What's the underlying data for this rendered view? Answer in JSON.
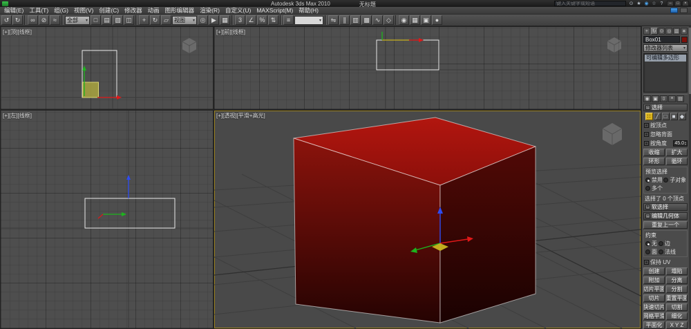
{
  "titlebar": {
    "app_title": "Autodesk 3ds Max 2010",
    "doc_title": "无标题",
    "search_placeholder": "键入关键字或短语",
    "window_buttons": [
      "–",
      "□",
      "×"
    ],
    "infocenter_icons": [
      {
        "name": "search-go-icon",
        "glyph": "⊙"
      },
      {
        "name": "subscription-center-icon",
        "glyph": "★"
      },
      {
        "name": "communication-center-icon",
        "glyph": "◉",
        "color": "#4aa0e8"
      },
      {
        "name": "favorites-icon",
        "glyph": "☆"
      },
      {
        "name": "help-icon",
        "glyph": "?"
      }
    ]
  },
  "menubar": {
    "items": [
      "编辑(E)",
      "工具(T)",
      "组(G)",
      "视图(V)",
      "创建(C)",
      "修改器",
      "动画",
      "图形编辑器",
      "渲染(R)",
      "自定义(U)",
      "MAXScript(M)",
      "帮助(H)"
    ]
  },
  "toolbar": {
    "items": [
      {
        "type": "icon",
        "name": "undo-icon",
        "glyph": "↺"
      },
      {
        "type": "icon",
        "name": "redo-icon",
        "glyph": "↻"
      },
      {
        "type": "sep"
      },
      {
        "type": "icon",
        "name": "select-and-link-icon",
        "glyph": "∞"
      },
      {
        "type": "icon",
        "name": "unlink-selection-icon",
        "glyph": "⊘"
      },
      {
        "type": "icon",
        "name": "bind-to-space-warp-icon",
        "glyph": "≈"
      },
      {
        "type": "sep"
      },
      {
        "type": "dropdown",
        "name": "selection-filter-dropdown",
        "value": "全部"
      },
      {
        "type": "icon",
        "name": "select-object-icon",
        "glyph": "□"
      },
      {
        "type": "icon",
        "name": "select-by-name-icon",
        "glyph": "▤"
      },
      {
        "type": "icon",
        "name": "rectangular-selection-region-icon",
        "glyph": "▧"
      },
      {
        "type": "icon",
        "name": "window-crossing-icon",
        "glyph": "◫"
      },
      {
        "type": "sep"
      },
      {
        "type": "icon",
        "name": "select-and-move-icon",
        "glyph": "+"
      },
      {
        "type": "icon",
        "name": "select-and-rotate-icon",
        "glyph": "↻"
      },
      {
        "type": "icon",
        "name": "select-and-scale-icon",
        "glyph": "▱"
      },
      {
        "type": "dropdown",
        "name": "reference-coordinate-dropdown",
        "value": "视图"
      },
      {
        "type": "icon",
        "name": "use-pivot-center-icon",
        "glyph": "◎"
      },
      {
        "type": "icon",
        "name": "select-and-manipulate-icon",
        "glyph": "▶"
      },
      {
        "type": "icon",
        "name": "keyboard-shortcut-override-icon",
        "glyph": "▦"
      },
      {
        "type": "sep"
      },
      {
        "type": "icon",
        "name": "snap-toggle-3d-icon",
        "glyph": "3"
      },
      {
        "type": "icon",
        "name": "angle-snap-icon",
        "glyph": "∠"
      },
      {
        "type": "icon",
        "name": "percent-snap-icon",
        "glyph": "%"
      },
      {
        "type": "icon",
        "name": "spinner-snap-icon",
        "glyph": "⇅"
      },
      {
        "type": "sep"
      },
      {
        "type": "icon",
        "name": "edit-named-selection-sets-icon",
        "glyph": "≡"
      },
      {
        "type": "combo",
        "name": "named-selection-sets-combo",
        "value": ""
      },
      {
        "type": "sep"
      },
      {
        "type": "icon",
        "name": "mirror-icon",
        "glyph": "⇋"
      },
      {
        "type": "icon",
        "name": "align-icon",
        "glyph": "∥"
      },
      {
        "type": "icon",
        "name": "layer-manager-icon",
        "glyph": "▥"
      },
      {
        "type": "icon",
        "name": "graphite-modeling-tools-icon",
        "glyph": "▩"
      },
      {
        "type": "icon",
        "name": "curve-editor-icon",
        "glyph": "∿"
      },
      {
        "type": "icon",
        "name": "schematic-view-icon",
        "glyph": "◇"
      },
      {
        "type": "sep"
      },
      {
        "type": "icon",
        "name": "material-editor-icon",
        "glyph": "◉"
      },
      {
        "type": "icon",
        "name": "render-setup-icon",
        "glyph": "▦"
      },
      {
        "type": "icon",
        "name": "rendered-frame-window-icon",
        "glyph": "▣"
      },
      {
        "type": "icon",
        "name": "render-production-icon",
        "glyph": "●"
      }
    ]
  },
  "viewports": {
    "top_label": "[+][顶][线框]",
    "front_label": "[+][前][线框]",
    "left_label": "[+][左][线框]",
    "perspective_label": "[+][透视][平滑+高光]"
  },
  "command_panel": {
    "tabs": [
      {
        "name": "create-tab-icon",
        "glyph": "+",
        "active": false
      },
      {
        "name": "modify-tab-icon",
        "glyph": "↻",
        "active": true
      },
      {
        "name": "hierarchy-tab-icon",
        "glyph": "⊙",
        "active": false
      },
      {
        "name": "motion-tab-icon",
        "glyph": "◎",
        "active": false
      },
      {
        "name": "display-tab-icon",
        "glyph": "▥",
        "active": false
      },
      {
        "name": "utilities-tab-icon",
        "glyph": "∗",
        "active": false
      }
    ],
    "object_name": "Box01",
    "modifier_list": "修改器列表",
    "stack_items": [
      "可编辑多边形"
    ],
    "stack_tools": [
      {
        "name": "pin-stack-icon",
        "glyph": "◉"
      },
      {
        "name": "show-end-result-icon",
        "glyph": "▣"
      },
      {
        "name": "make-unique-icon",
        "glyph": "⇩"
      },
      {
        "name": "remove-modifier-icon",
        "glyph": "×"
      },
      {
        "name": "configure-modifier-sets-icon",
        "glyph": "▤"
      }
    ],
    "selection": {
      "header": "选择",
      "subobject_icons": [
        {
          "name": "vertex-subobject-icon",
          "glyph": "∷",
          "active": true
        },
        {
          "name": "edge-subobject-icon",
          "glyph": "╱",
          "active": false
        },
        {
          "name": "border-subobject-icon",
          "glyph": "□",
          "active": false
        },
        {
          "name": "polygon-subobject-icon",
          "glyph": "■",
          "active": false
        },
        {
          "name": "element-subobject-icon",
          "glyph": "◆",
          "active": false
        }
      ],
      "by_vertex": "按顶点",
      "ignore_backfacing": "忽略背面",
      "by_angle": "按角度",
      "by_angle_value": "45.0",
      "shrink": "收缩",
      "grow": "扩大",
      "ring": "环形",
      "loop": "循环",
      "preview_label": "预览选择",
      "preview_off": "禁用",
      "preview_subobj": "子对象",
      "preview_multi": "多个",
      "status": "选择了 0 个顶点"
    },
    "soft_selection_header": "软选择",
    "edit_geometry": {
      "header": "编辑几何体",
      "repeat_last": "重复上一个",
      "constraints_label": "约束",
      "constraint_none": "无",
      "constraint_edge": "边",
      "constraint_face": "面",
      "constraint_normal": "法线",
      "preserve_uvs": "保持 UV",
      "buttons": [
        [
          "创建",
          "塌陷"
        ],
        [
          "附加",
          "分离"
        ],
        [
          "切片平面",
          "分割"
        ],
        [
          "切片",
          "重置平面"
        ],
        [
          "快速切片",
          "切割"
        ],
        [
          "网格平滑",
          "细化"
        ],
        [
          "平面化",
          "X Y Z"
        ]
      ]
    }
  },
  "colors": {
    "viewport_bg": "#4e4e4e",
    "box_top": "#b2160f",
    "box_front_bottom": "#250302",
    "box_right": "#510906",
    "gizmo_x": "#e01818",
    "gizmo_y": "#1db41d",
    "gizmo_z": "#2e4bf0",
    "active_subobject_highlight": "#d9b31f",
    "active_viewport_border": "#deb000"
  }
}
